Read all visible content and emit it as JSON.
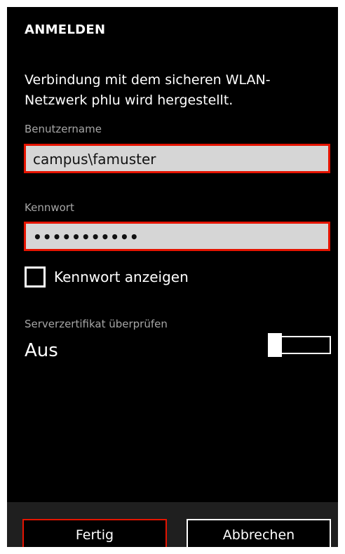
{
  "dialog": {
    "title": "ANMELDEN",
    "message": "Verbindung mit dem sicheren WLAN-Netzwerk phlu wird hergestellt."
  },
  "username": {
    "label": "Benutzername",
    "value": "campus\\famuster"
  },
  "password": {
    "label": "Kennwort",
    "masked_value": "•••••••••••"
  },
  "show_password": {
    "label": "Kennwort anzeigen",
    "checked": false
  },
  "server_certificate": {
    "label": "Serverzertifikat überprüfen",
    "value": "Aus",
    "enabled": false
  },
  "buttons": {
    "done_label": "Fertig",
    "cancel_label": "Abbrechen"
  },
  "colors": {
    "accent": "#e51400",
    "background": "#000000",
    "textbox": "#d6d6d6"
  }
}
